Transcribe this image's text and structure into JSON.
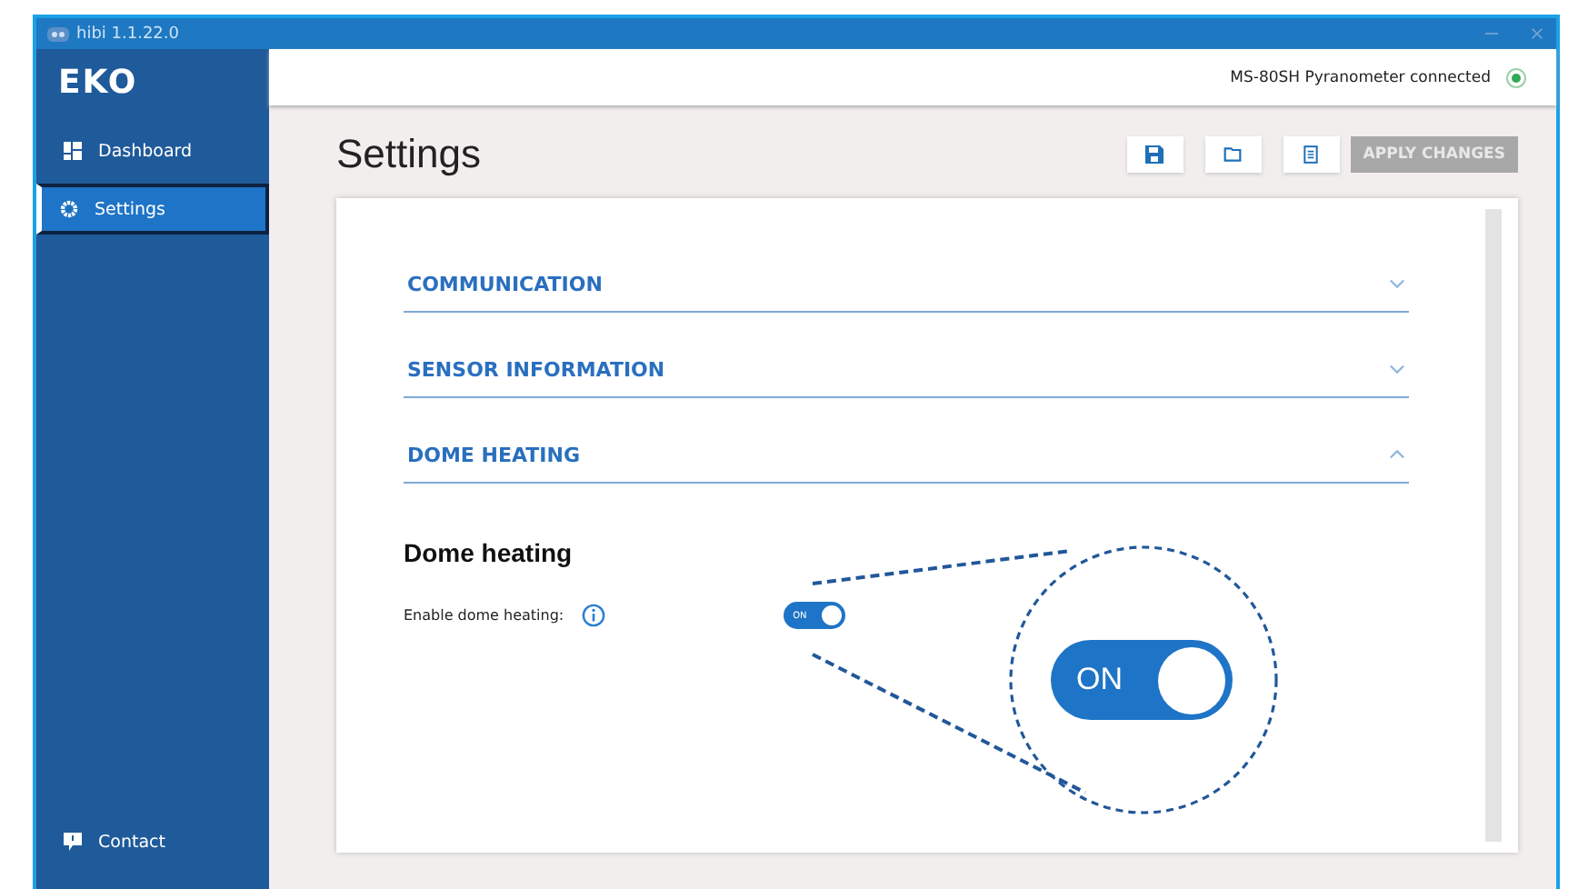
{
  "window": {
    "title": "hibi 1.1.22.0"
  },
  "sidebar": {
    "logo": "EKO",
    "items": [
      {
        "label": "Dashboard",
        "kind": "dashboard",
        "selected": false
      },
      {
        "label": "Settings",
        "kind": "gear",
        "selected": true
      }
    ],
    "footer": {
      "label": "Contact"
    }
  },
  "header": {
    "status": "MS-80SH Pyranometer connected",
    "connected": true
  },
  "page": {
    "title": "Settings",
    "apply_button": {
      "label": "APPLY CHANGES",
      "disabled": true
    }
  },
  "sections": [
    {
      "title": "COMMUNICATION",
      "expanded": false
    },
    {
      "title": "SENSOR INFORMATION",
      "expanded": false
    },
    {
      "title": "DOME HEATING",
      "expanded": true
    }
  ],
  "dome_heating": {
    "heading": "Dome heating",
    "label": "Enable dome heating:",
    "toggle": {
      "label": "ON",
      "on": true
    }
  },
  "callout": {
    "toggle": {
      "label": "ON",
      "on": true
    }
  }
}
